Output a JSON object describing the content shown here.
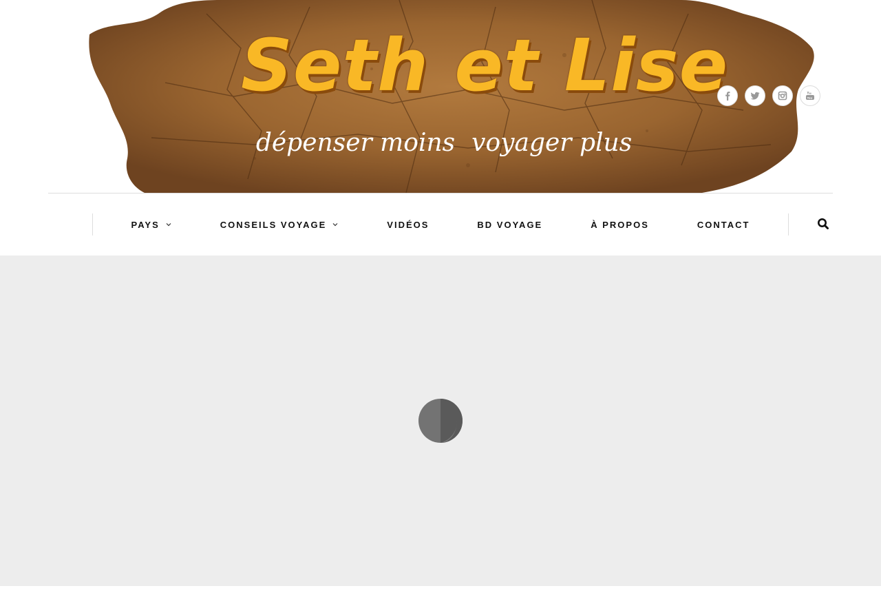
{
  "brand": {
    "title": "Seth et Lise",
    "tagline_part1": "dépenser moins",
    "tagline_part2": "voyager plus",
    "title_color": "#f9b826",
    "wood_color": "#8b5a2b"
  },
  "social": [
    {
      "name": "facebook-icon",
      "glyph": "f"
    },
    {
      "name": "twitter-icon",
      "glyph": "twitter"
    },
    {
      "name": "instagram-icon",
      "glyph": "instagram"
    },
    {
      "name": "youtube-icon",
      "glyph": "youtube"
    }
  ],
  "nav": {
    "items": [
      {
        "label": "PAYS",
        "has_dropdown": true
      },
      {
        "label": "CONSEILS VOYAGE",
        "has_dropdown": true
      },
      {
        "label": "VIDÉOS",
        "has_dropdown": false
      },
      {
        "label": "BD VOYAGE",
        "has_dropdown": false
      },
      {
        "label": "À PROPOS",
        "has_dropdown": false
      },
      {
        "label": "CONTACT",
        "has_dropdown": false
      }
    ],
    "search_icon": "search-icon"
  },
  "main": {
    "background": "#ededed",
    "loader_icon": "loading-spinner-icon"
  }
}
